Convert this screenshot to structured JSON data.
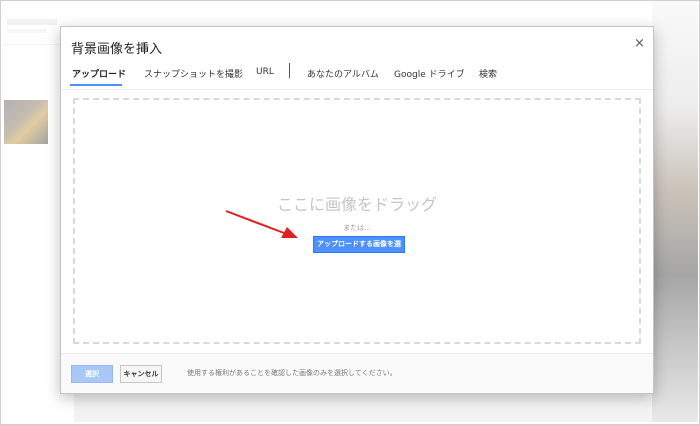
{
  "dialog": {
    "title": "背景画像を挿入",
    "close_glyph": "×"
  },
  "tabs": [
    {
      "label": "アップロード",
      "active": true
    },
    {
      "label": "スナップショットを撮影",
      "active": false
    },
    {
      "label": "URL",
      "active": false
    },
    {
      "label": "あなたのアルバム",
      "active": false
    },
    {
      "label": "Google ドライブ",
      "active": false
    },
    {
      "label": "検索",
      "active": false
    }
  ],
  "dropzone": {
    "drop_text": "ここに画像をドラッグ",
    "or_text": "または...",
    "select_button": "アップロードする画像を選択"
  },
  "footer": {
    "select_label": "選択",
    "cancel_label": "キャンセル",
    "note": "使用する権利があることを確認した画像のみを選択してください。"
  },
  "annotation": {
    "arrow_color": "#e02020",
    "arrow_icon": "arrow-pointer-icon"
  },
  "colors": {
    "primary_button": "#4d90fe",
    "disabled_button": "#a9c7f7"
  }
}
